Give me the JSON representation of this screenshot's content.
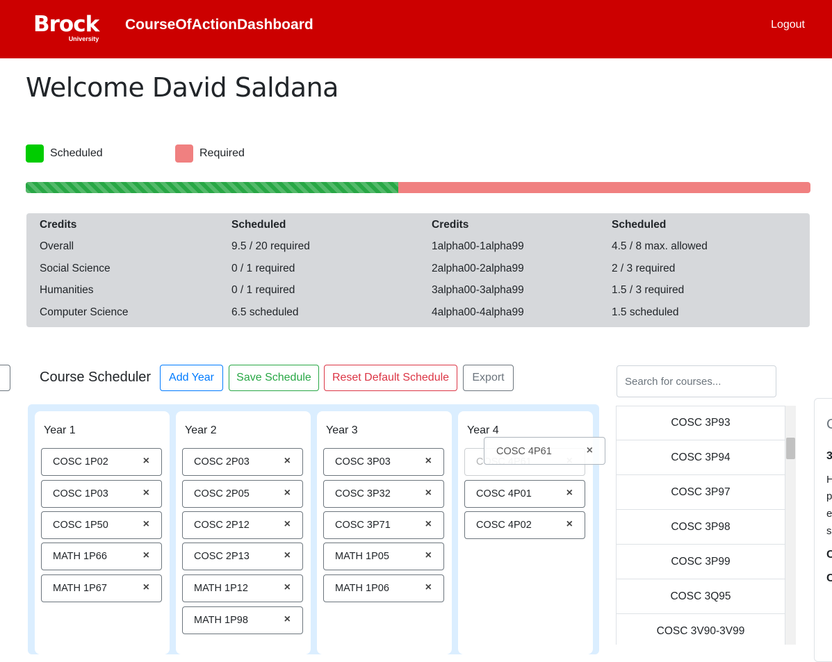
{
  "navbar": {
    "logo_text": "Brock",
    "logo_sub": "University",
    "brand": "CourseOfActionDashboard",
    "logout": "Logout",
    "color": "#cc0000"
  },
  "welcome": "Welcome David Saldana",
  "legend": [
    {
      "label": "Scheduled",
      "color": "#00cc00"
    },
    {
      "label": "Required",
      "color": "#f08080"
    }
  ],
  "progress": {
    "scheduled_fraction": 0.475
  },
  "credits": {
    "headers": [
      "Credits",
      "Scheduled",
      "Credits",
      "Scheduled"
    ],
    "rows": [
      [
        "Overall",
        "9.5 / 20 required",
        "1alpha00-1alpha99",
        "4.5 / 8 max. allowed"
      ],
      [
        "Social Science",
        "0 / 1 required",
        "2alpha00-2alpha99",
        "2 / 3 required"
      ],
      [
        "Humanities",
        "0 / 1 required",
        "3alpha00-3alpha99",
        "1.5 / 3 required"
      ],
      [
        "Computer Science",
        "6.5 scheduled",
        "4alpha00-4alpha99",
        "1.5 scheduled"
      ]
    ]
  },
  "scheduler": {
    "title": "Course Scheduler",
    "buttons": {
      "add_year": "Add Year",
      "save": "Save Schedule",
      "reset": "Reset Default Schedule",
      "export": "Export"
    },
    "search_placeholder": "Search for courses...",
    "remove_glyph": "×",
    "years": [
      {
        "title": "Year 1",
        "courses": [
          "COSC 1P02",
          "COSC 1P03",
          "COSC 1P50",
          "MATH 1P66",
          "MATH 1P67"
        ]
      },
      {
        "title": "Year 2",
        "courses": [
          "COSC 2P03",
          "COSC 2P05",
          "COSC 2P12",
          "COSC 2P13",
          "MATH 1P12",
          "MATH 1P98"
        ]
      },
      {
        "title": "Year 3",
        "courses": [
          "COSC 3P03",
          "COSC 3P32",
          "COSC 3P71",
          "MATH 1P05",
          "MATH 1P06"
        ]
      },
      {
        "title": "Year 4",
        "courses": [
          "COSC 4P61",
          "COSC 4P01",
          "COSC 4P02"
        ]
      }
    ],
    "dragging": "COSC 4P61"
  },
  "course_list": [
    "COSC 3P93",
    "COSC 3P94",
    "COSC 3P97",
    "COSC 3P98",
    "COSC 3P99",
    "COSC 3Q95",
    "COSC 3V90-3V99"
  ],
  "detail_fragments": [
    "C",
    "3",
    "H",
    "p",
    "e",
    "s",
    "C",
    "C"
  ]
}
